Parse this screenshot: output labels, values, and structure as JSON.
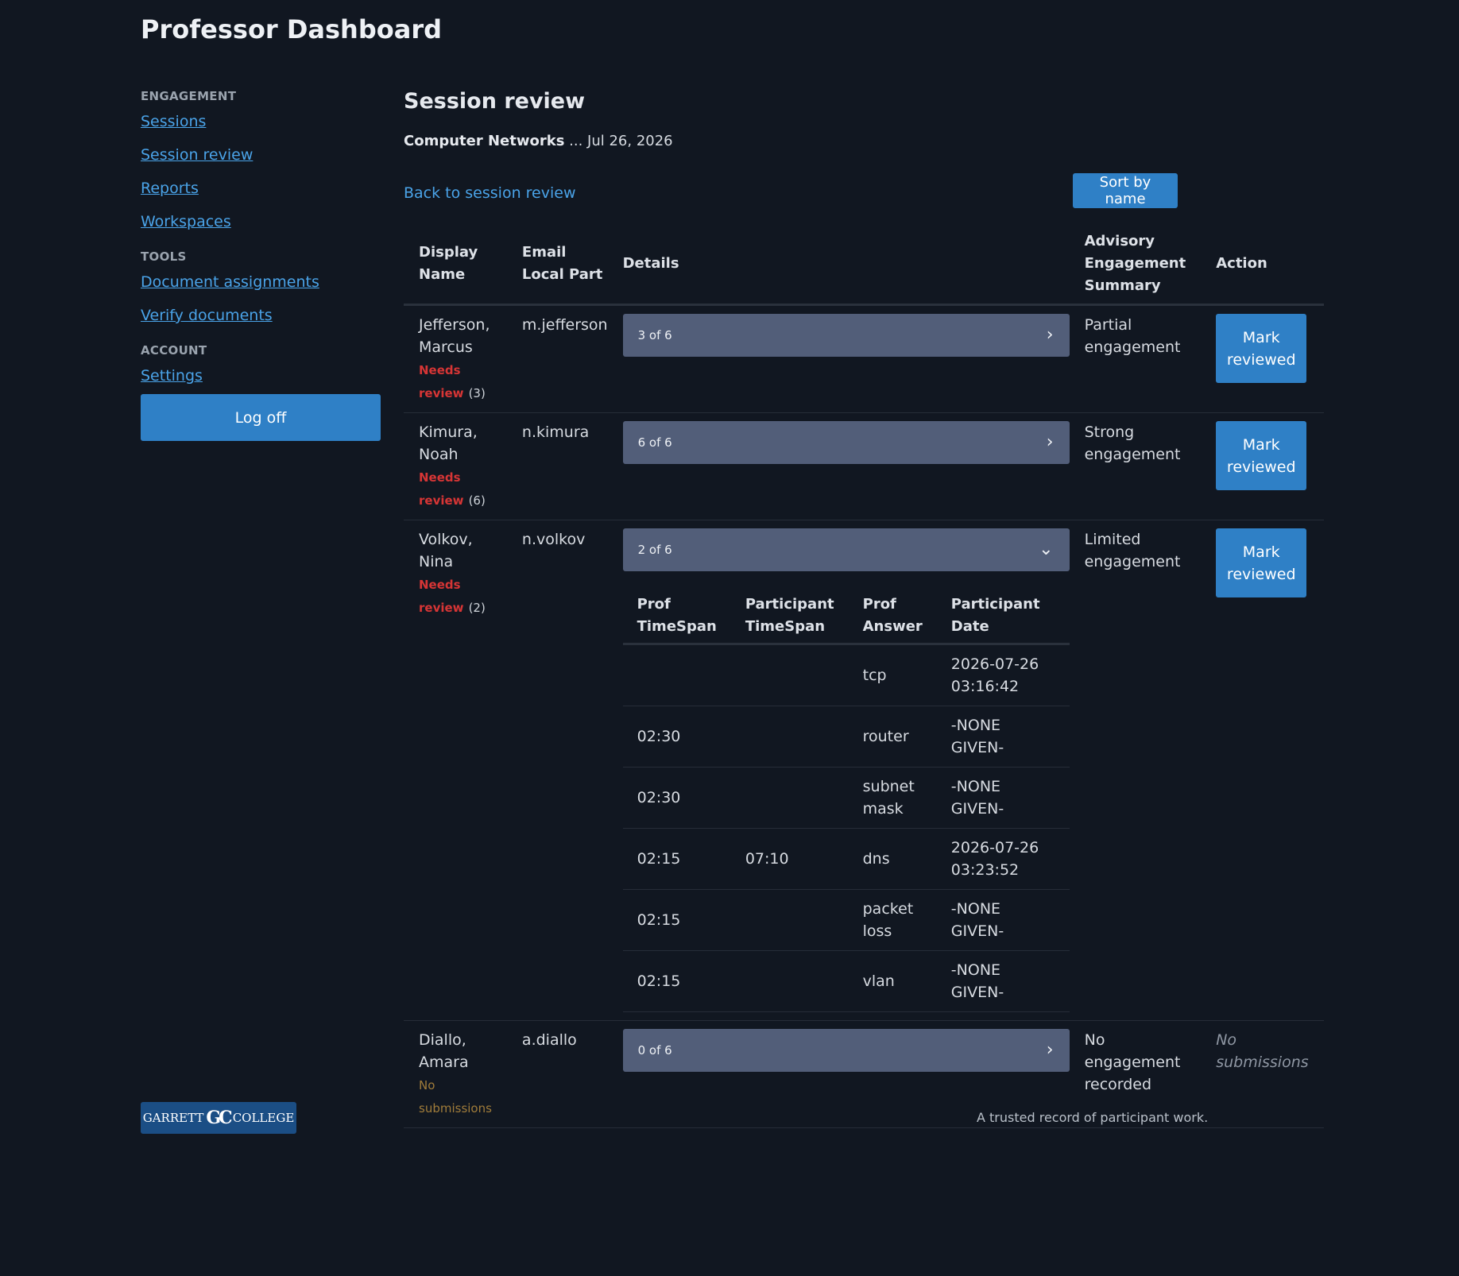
{
  "app": {
    "title": "Professor Dashboard"
  },
  "sidebar": {
    "sections": [
      {
        "heading": "ENGAGEMENT",
        "links": [
          "Sessions",
          "Session review",
          "Reports",
          "Workspaces"
        ]
      },
      {
        "heading": "TOOLS",
        "links": [
          "Document assignments",
          "Verify documents"
        ]
      },
      {
        "heading": "ACCOUNT",
        "links": [
          "Settings"
        ]
      }
    ],
    "logoff_label": "Log off"
  },
  "main": {
    "title": "Session review",
    "course": "Computer Networks",
    "session_date": "... Jul 26, 2026",
    "back_link": "Back to session review",
    "sort_button": "Sort by name",
    "columns": [
      "Display Name",
      "Email Local Part",
      "Details",
      "Advisory Engagement Summary",
      "Action"
    ],
    "rows": [
      {
        "name": "Jefferson, Marcus",
        "status": "Needs review",
        "status_count": "(3)",
        "email": "m.jefferson",
        "details": "3 of 6",
        "expanded": false,
        "summary": "Partial engagement",
        "action": "Mark reviewed"
      },
      {
        "name": "Kimura, Noah",
        "status": "Needs review",
        "status_count": "(6)",
        "email": "n.kimura",
        "details": "6 of 6",
        "expanded": false,
        "summary": "Strong engagement",
        "action": "Mark reviewed"
      },
      {
        "name": "Volkov, Nina",
        "status": "Needs review",
        "status_count": "(2)",
        "email": "n.volkov",
        "details": "2 of 6",
        "expanded": true,
        "summary": "Limited engagement",
        "action": "Mark reviewed",
        "answers": {
          "columns": [
            "Prof TimeSpan",
            "Participant TimeSpan",
            "Prof Answer",
            "Participant Date"
          ],
          "rows": [
            [
              "",
              "",
              "tcp",
              "2026-07-26 03:16:42"
            ],
            [
              "02:30",
              "",
              "router",
              "-NONE GIVEN-"
            ],
            [
              "02:30",
              "",
              "subnet mask",
              "-NONE GIVEN-"
            ],
            [
              "02:15",
              "07:10",
              "dns",
              "2026-07-26 03:23:52"
            ],
            [
              "02:15",
              "",
              "packet loss",
              "-NONE GIVEN-"
            ],
            [
              "02:15",
              "",
              "vlan",
              "-NONE GIVEN-"
            ]
          ]
        }
      },
      {
        "name": "Diallo, Amara",
        "status": "No submissions",
        "status_count": "",
        "email": "a.diallo",
        "details": "0 of 6",
        "expanded": false,
        "summary": "No engagement recorded",
        "action": "No submissions"
      }
    ]
  },
  "footer": {
    "logo_left": "GARRETT",
    "logo_mark": "GC",
    "logo_right": "COLLEGE",
    "tagline": "A trusted record of participant work."
  },
  "colors": {
    "background": "#111721",
    "accent": "#2f80c6",
    "link": "#4aa3e8",
    "needs_review": "#d63535",
    "details_bar": "#525e79"
  },
  "icons": {
    "collapsed": "chevron-right-icon",
    "expanded": "chevron-down-icon"
  }
}
